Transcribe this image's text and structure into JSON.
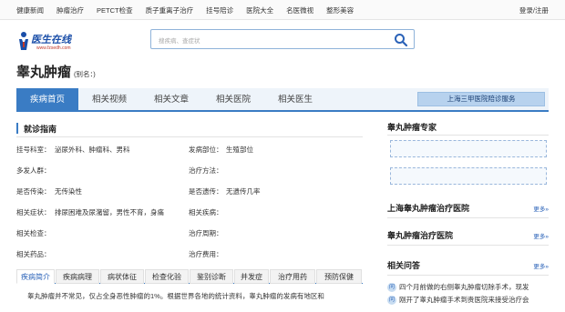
{
  "topnav": {
    "items": [
      "健康新闻",
      "肿瘤治疗",
      "PETCT检查",
      "质子重离子治疗",
      "挂号陪诊",
      "医院大全",
      "名医微视",
      "整形美容"
    ],
    "login": "登录/注册"
  },
  "logo": {
    "name": "医生在线",
    "url": "www.fzsedh.com"
  },
  "search": {
    "placeholder": "搜疾病、查症状"
  },
  "disease": {
    "title": "睾丸肿瘤",
    "alias": "(别名：)"
  },
  "tabs": [
    "疾病首页",
    "相关视频",
    "相关文章",
    "相关医院",
    "相关医生"
  ],
  "cta": "上海三甲医院陪诊服务",
  "guide": {
    "title": "就诊指南",
    "rows": [
      {
        "l1": "挂号科室：",
        "v1": "泌尿外科、肿瘤科、男科",
        "l2": "发病部位：",
        "v2": "生殖部位"
      },
      {
        "l1": "多发人群：",
        "v1": "",
        "l2": "治疗方法：",
        "v2": ""
      },
      {
        "l1": "是否传染：",
        "v1": "无传染性",
        "l2": "是否遗传：",
        "v2": "无遗传几率"
      },
      {
        "l1": "相关症状：",
        "v1": "排尿困难及尿潴留，男性不育，身痛",
        "l2": "相关疾病：",
        "v2": ""
      },
      {
        "l1": "相关检查：",
        "v1": "",
        "l2": "治疗周期：",
        "v2": ""
      },
      {
        "l1": "相关药品：",
        "v1": "",
        "l2": "治疗费用：",
        "v2": ""
      }
    ]
  },
  "bottomtabs": [
    "疾病简介",
    "疾病病理",
    "病状体征",
    "检查化验",
    "鉴别诊断",
    "并发症",
    "治疗用药",
    "预防保健"
  ],
  "intro": "睾丸肿瘤并不常见，仅占全身恶性肿瘤的1%。根据世界各地的统计资料，睾丸肿瘤的发病有地区和",
  "right": {
    "expert_title": "睾丸肿瘤专家",
    "more": "更多»",
    "sh_hospital_title": "上海睾丸肿瘤治疗医院",
    "hospital_title": "睾丸肿瘤治疗医院",
    "qa_title": "相关问答",
    "qa_icon": "问",
    "qa_items": [
      "四个月前做的右侧睾丸肿瘤切除手术，现发",
      "刚开了睾丸肿瘤手术到贵医院来接受治疗会"
    ]
  },
  "colors": {
    "accent": "#3a7cc4",
    "link": "#2a62b8"
  }
}
